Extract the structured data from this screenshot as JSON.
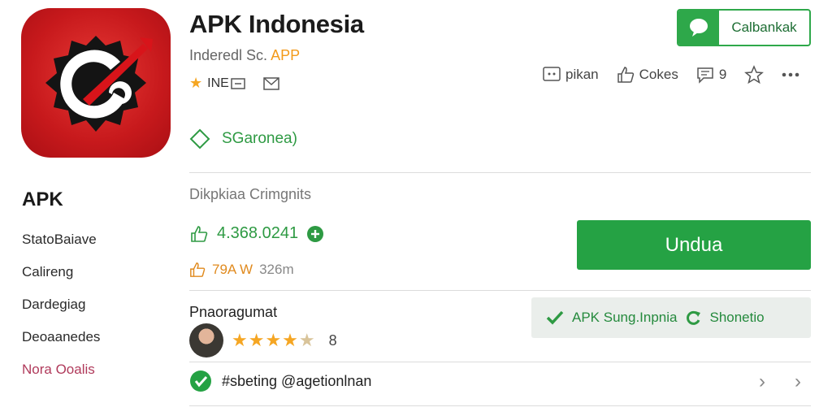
{
  "app": {
    "title": "APK Indonesia",
    "developer_prefix": "Inderedl Sc.",
    "developer_accent": "APP",
    "rating_meta": "INE",
    "tag_label": "SGaronea)"
  },
  "chat_button": {
    "label": "Calbankak",
    "icon": "chat-bubble-icon"
  },
  "actions": [
    {
      "label": "pikan",
      "icon": "screen-icon"
    },
    {
      "label": "Cokes",
      "icon": "thumbs-up-icon"
    },
    {
      "label": "9",
      "icon": "comment-icon"
    },
    {
      "label": "",
      "icon": "star-outline-icon"
    },
    {
      "label": "",
      "icon": "more-icon"
    }
  ],
  "sidebar": {
    "title": "APK",
    "items": [
      "StatoBaiave",
      "Calireng",
      "Dardegiag",
      "Deoaanedes",
      "Nora Ooalis"
    ],
    "active_index": 4
  },
  "download": {
    "heading": "Dikpkiaa Crimgnits",
    "count": "4.368.0241",
    "size": "79A W",
    "size_sub": "326m",
    "button_label": "Undua"
  },
  "verify": {
    "label": "APK Sung.Inpnia",
    "secondary": "Shonetio"
  },
  "reviews": {
    "heading": "Pnaoragumat",
    "rating": 4.5,
    "count": "8"
  },
  "check_row": {
    "label": "#sbeting @agetionlnan"
  },
  "colors": {
    "green": "#25a244",
    "orange": "#f39a1a",
    "red": "#c7191c",
    "pink": "#b03a5b"
  }
}
